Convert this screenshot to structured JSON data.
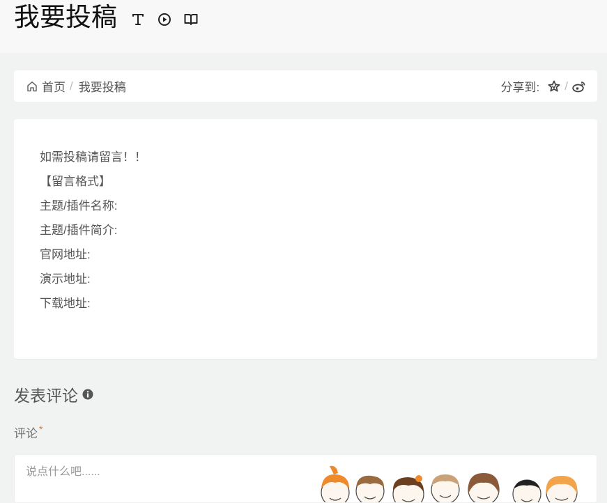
{
  "header": {
    "title": "我要投稿",
    "icons": [
      "text-icon",
      "play-circle-icon",
      "book-icon"
    ]
  },
  "breadcrumb": {
    "home_label": "首页",
    "separator": "/",
    "current": "我要投稿"
  },
  "share": {
    "label": "分享到:",
    "separator": "/",
    "icons": [
      "star-icon",
      "weibo-icon"
    ]
  },
  "content": {
    "lines": [
      "如需投稿请留言！！",
      "【留言格式】",
      "主题/插件名称:",
      "主题/插件简介:",
      "官网地址:",
      "演示地址:",
      "下载地址:"
    ]
  },
  "comment": {
    "heading": "发表评论",
    "field_label": "评论",
    "required_mark": "*",
    "placeholder": "说点什么吧......"
  },
  "colors": {
    "page_bg": "#f1f3f2",
    "card_bg": "#ffffff",
    "text": "#555555",
    "required": "#e8743b"
  }
}
